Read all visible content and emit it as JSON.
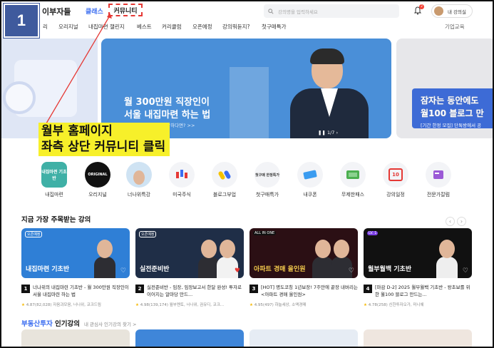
{
  "header": {
    "logo": "이부자들",
    "class_label": "클래스",
    "community_label": "커뮤니티",
    "search_placeholder": "강의명을 입력하세요",
    "bell_badge": "2",
    "user_name": "내 강의실"
  },
  "subnav": {
    "items": [
      "리",
      "오리지널",
      "내집마련 챌린지",
      "베스트",
      "커리큘럼",
      "오픈예정",
      "강의뭐듣지?",
      "첫구매특가"
    ],
    "right": "기업교육"
  },
  "step_number": "1",
  "hero": {
    "main_title_1": "월 300만원 직장인이",
    "main_title_2": "서울 내집마련 하는 법",
    "main_sub": "[기초반] 그 시작이 막막하다면? >>",
    "pager": "1/7",
    "right_title_1": "잠자는 동안에도",
    "right_title_2": "월100 블로그 만",
    "right_sub": "[기간 한정 모집] 단톡방에서 공"
  },
  "annotation": {
    "line1": "월부 홈페이지",
    "line2": "좌측 상단 커뮤니티 클릭"
  },
  "categories": [
    {
      "label": "내집마련",
      "icon": "내집마련 기초반"
    },
    {
      "label": "오리지널",
      "icon": "ORIGINAL"
    },
    {
      "label": "너나위특강",
      "icon": ""
    },
    {
      "label": "미국주식",
      "icon": ""
    },
    {
      "label": "블로그부업",
      "icon": ""
    },
    {
      "label": "첫구매특가",
      "icon": "첫구매 한정특가"
    },
    {
      "label": "내쿠폰",
      "icon": ""
    },
    {
      "label": "무제한패스",
      "icon": ""
    },
    {
      "label": "강의일정",
      "icon": "10"
    },
    {
      "label": "전문가칼럼",
      "icon": ""
    }
  ],
  "section1": {
    "title": "지금 가장 주목받는 강의",
    "cards": [
      {
        "num": "1",
        "tag": "오픈예정",
        "thumb_title": "내집마련 기초반",
        "desc": "너나위의 내집마련 기초반 - 월 300만원 직장인이 서울 내집마련 하는 법",
        "meta": "4.87(82,028)  자음과모음, 너나위, 코크드림"
      },
      {
        "num": "2",
        "tag": "오픈예정",
        "thumb_title": "실전준비반",
        "desc": "실전준비반 - 임장, 임장보고서 한달 완성! 투자로 이어지는 알마당 만드...",
        "meta": "4.98(139,174)  월부멘토, 너나위, 권유디, 코크..."
      },
      {
        "num": "3",
        "tag": "ALL IN ONE",
        "thumb_title": "아파트 경매 올인원",
        "desc": "[HOT] 명도코칭 1년보장! 7주만에 끝장 내버리는 <아파트 경매 올인원>",
        "meta": "4.95(497)  하늘세상, 소액경매"
      },
      {
        "num": "4",
        "tag": "LV. 1",
        "thumb_title": "월부월백 기초반",
        "desc": "[마감 D-2] 2025 월부월백 기초반 - 왕초보를 위한 월100 블로그 만드는...",
        "meta": "4.78(258)  신한투자오가, 미니쉐"
      }
    ]
  },
  "section2": {
    "title_a": "부동산투자",
    "title_b": " 인기강의",
    "sub": "내 관심사 인기강의 찾기 >"
  },
  "colors": {
    "accent": "#3b6df0",
    "step_box": "#3f5a9d",
    "highlight": "#f7f02a",
    "highlight_border": "#e53935"
  }
}
